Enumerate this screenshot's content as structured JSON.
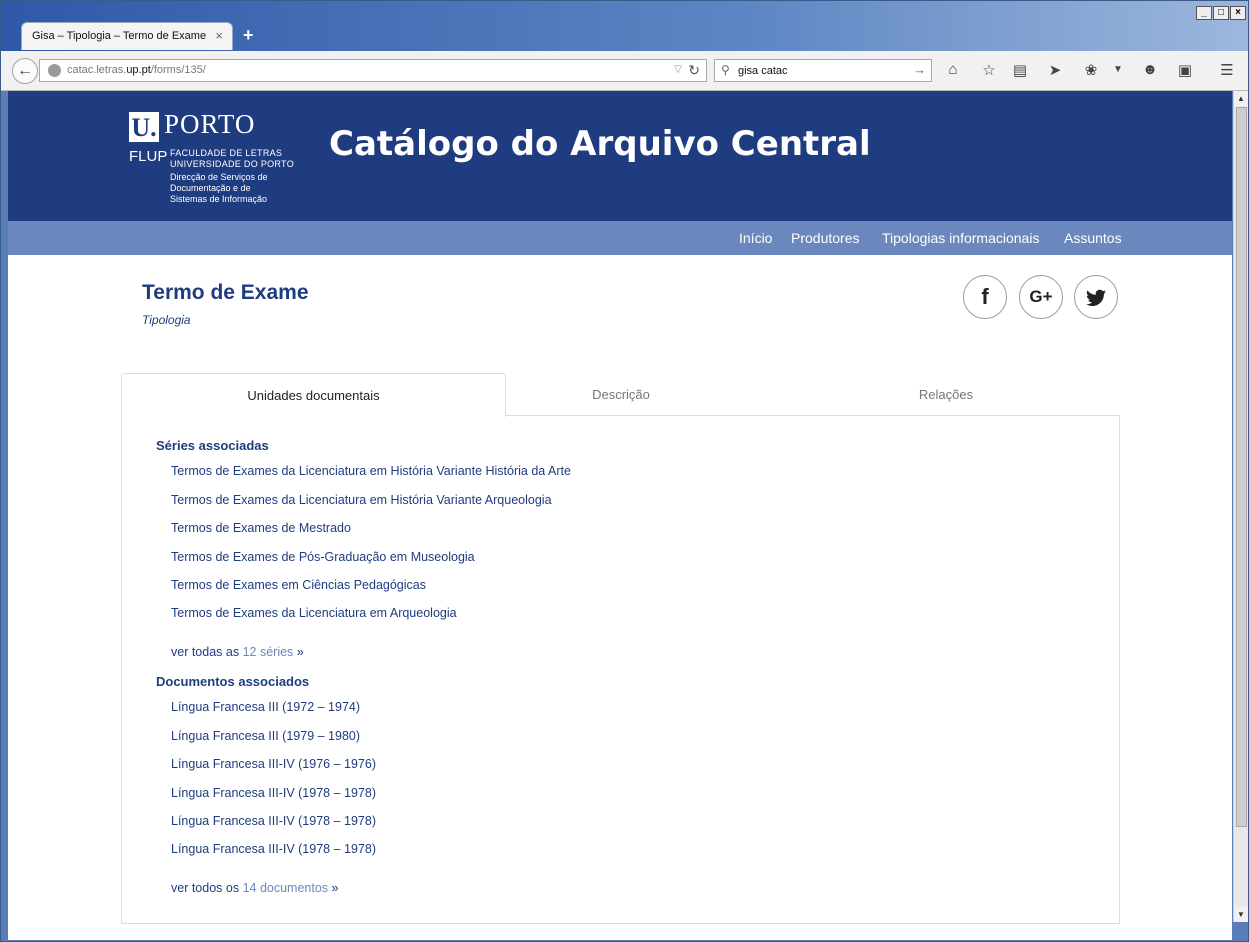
{
  "browser": {
    "tab_title": "Gisa – Tipologia – Termo de Exame",
    "tab_close": "×",
    "new_tab": "+",
    "url_prefix": "catac.letras.",
    "url_domain": "up.pt",
    "url_path": "/forms/135/",
    "search_value": "gisa catac",
    "window_controls": {
      "minimize": "_",
      "maximize": "□",
      "close": "×"
    }
  },
  "header": {
    "logo_u": "U.",
    "logo_porto": "PORTO",
    "logo_flup": "FLUP",
    "logo_faculty_line1": "FACULDADE DE LETRAS",
    "logo_faculty_line2": "UNIVERSIDADE DO PORTO",
    "logo_dir_line1": "Direcção de Serviços de",
    "logo_dir_line2": "Documentação e de",
    "logo_dir_line3": "Sistemas de Informação",
    "site_title": "Catálogo do Arquivo Central"
  },
  "nav": {
    "items": [
      "Início",
      "Produtores",
      "Tipologias informacionais",
      "Assuntos"
    ]
  },
  "page": {
    "title": "Termo de Exame",
    "subtitle": "Tipologia"
  },
  "social": {
    "facebook": "f",
    "google": "G+",
    "twitter": "🐦"
  },
  "tabs": [
    "Unidades documentais",
    "Descrição",
    "Relações"
  ],
  "series": {
    "heading": "Séries associadas",
    "items": [
      "Termos de Exames da Licenciatura em História Variante História da Arte",
      "Termos de Exames da Licenciatura em História Variante Arqueologia",
      "Termos de Exames de Mestrado",
      "Termos de Exames de Pós-Graduação em Museologia",
      "Termos de Exames em Ciências Pedagógicas",
      "Termos de Exames da Licenciatura em Arqueologia"
    ],
    "more_prefix": "ver todas as",
    "more_link": "12 séries",
    "more_suffix": "»"
  },
  "documents": {
    "heading": "Documentos associados",
    "items": [
      "Língua Francesa III (1972 – 1974)",
      "Língua Francesa III (1979 – 1980)",
      "Língua Francesa III-IV (1976 – 1976)",
      "Língua Francesa III-IV (1978 – 1978)",
      "Língua Francesa III-IV (1978 – 1978)",
      "Língua Francesa III-IV (1978 – 1978)"
    ],
    "more_prefix": "ver todos os",
    "more_link": "14 documentos",
    "more_suffix": "»"
  }
}
